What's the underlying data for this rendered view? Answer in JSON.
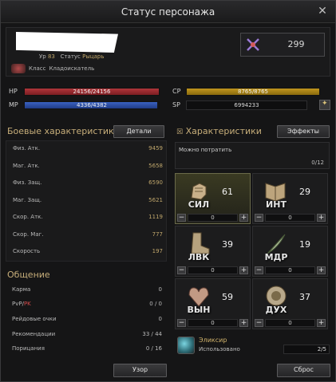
{
  "window": {
    "title": "Статус персонажа"
  },
  "profile": {
    "level_label": "Ур",
    "level": "83",
    "status_label": "Статус",
    "status": "Рыцарь",
    "class_label": "Класс",
    "class": "Кладоискатель"
  },
  "ability_points": "299",
  "bars": {
    "hp": {
      "label": "HP",
      "text": "24156/24156",
      "fill": 1.0
    },
    "mp": {
      "label": "MP",
      "text": "4336/4382",
      "fill": 0.99
    },
    "cp": {
      "label": "CP",
      "text": "8765/8765",
      "fill": 1.0
    },
    "sp": {
      "label": "SP",
      "text": "6994233"
    }
  },
  "combat": {
    "title": "Боевые характеристики",
    "details_button": "Детали",
    "rows": [
      {
        "label": "Физ. Атк.",
        "value": "9459"
      },
      {
        "label": "Маг. Атк.",
        "value": "5658"
      },
      {
        "label": "Физ. Защ.",
        "value": "6590"
      },
      {
        "label": "Маг. Защ.",
        "value": "5621"
      },
      {
        "label": "Скор. Атк.",
        "value": "1119"
      },
      {
        "label": "Скор. Маг.",
        "value": "777"
      },
      {
        "label": "Скорость",
        "value": "197"
      }
    ]
  },
  "social": {
    "title": "Общение",
    "rows": [
      {
        "label": "Карма",
        "value": "0"
      },
      {
        "label_pvp": "PvP",
        "label_slash": "/",
        "label_pk": "PK",
        "value": "0 / 0"
      },
      {
        "label": "Рейдовые очки",
        "value": "0"
      },
      {
        "label": "Рекомендации",
        "value": "33 / 44"
      },
      {
        "label": "Порицания",
        "value": "0 / 16"
      }
    ]
  },
  "stats": {
    "title": "Характеристики",
    "effects_button": "Эффекты",
    "spend_label": "Можно потратить",
    "spend_value": "0/12",
    "items": [
      {
        "abbr": "СИЛ",
        "value": "61",
        "added": "0",
        "icon": "fist-icon",
        "selected": true
      },
      {
        "abbr": "ИНТ",
        "value": "29",
        "added": "0",
        "icon": "book-icon",
        "selected": false
      },
      {
        "abbr": "ЛВК",
        "value": "39",
        "added": "0",
        "icon": "boot-icon",
        "selected": false
      },
      {
        "abbr": "МДР",
        "value": "19",
        "added": "0",
        "icon": "feather-icon",
        "selected": false
      },
      {
        "abbr": "ВЫН",
        "value": "59",
        "added": "0",
        "icon": "heart-icon",
        "selected": false
      },
      {
        "abbr": "ДУХ",
        "value": "37",
        "added": "0",
        "icon": "spirit-icon",
        "selected": false
      }
    ]
  },
  "elixir": {
    "name": "Эликсир",
    "used_label": "Использовано",
    "value": "2/5"
  },
  "footer": {
    "view_button": "Узор",
    "reset_button": "Сброс"
  },
  "colors": {
    "hp": "#b0353a",
    "mp": "#3a62c0",
    "cp": "#c1961e",
    "gold": "#bfa66b",
    "section": "#c7ae7a"
  }
}
